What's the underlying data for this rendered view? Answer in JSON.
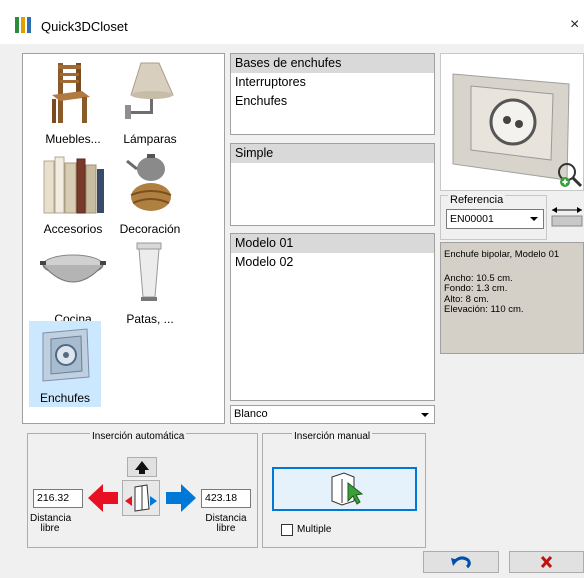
{
  "window": {
    "title": "Quick3DCloset",
    "close": "×"
  },
  "categories": [
    {
      "label": "Muebles...",
      "icon": "chair-icon"
    },
    {
      "label": "Lámparas",
      "icon": "lamp-icon"
    },
    {
      "label": "Accesorios",
      "icon": "books-icon"
    },
    {
      "label": "Decoración",
      "icon": "teapot-basket-icon"
    },
    {
      "label": "Cocina",
      "icon": "wok-icon"
    },
    {
      "label": "Patas, ...",
      "icon": "leg-icon"
    },
    {
      "label": "Enchufes",
      "icon": "socket-icon",
      "selected": true
    }
  ],
  "subcategories": {
    "selected": "Bases de enchufes",
    "items": [
      "Interruptores",
      "Enchufes"
    ]
  },
  "types": {
    "selected": "Simple"
  },
  "models": {
    "selected": "Modelo 01",
    "items": [
      "Modelo 02"
    ]
  },
  "color": {
    "value": "Blanco"
  },
  "reference": {
    "legend": "Referencia",
    "value": "EN00001"
  },
  "description": {
    "title": "Enchufe bipolar, Modelo 01",
    "lines": [
      "Ancho: 10.5 cm.",
      "Fondo: 1.3 cm.",
      "Alto: 8 cm.",
      "Elevación: 110 cm."
    ]
  },
  "auto_insert": {
    "legend": "Inserción automática",
    "left_value": "216.32",
    "right_value": "423.18",
    "left_label_1": "Distancia",
    "left_label_2": "libre",
    "right_label_1": "Distancia",
    "right_label_2": "libre"
  },
  "manual_insert": {
    "legend": "Inserción manual",
    "multiple_label": "Multiple",
    "multiple_checked": false
  },
  "colors": {
    "accent": "#0078d7",
    "arrow_red": "#e81123",
    "arrow_blue": "#0078d7",
    "selected_bg": "#cce8ff"
  }
}
